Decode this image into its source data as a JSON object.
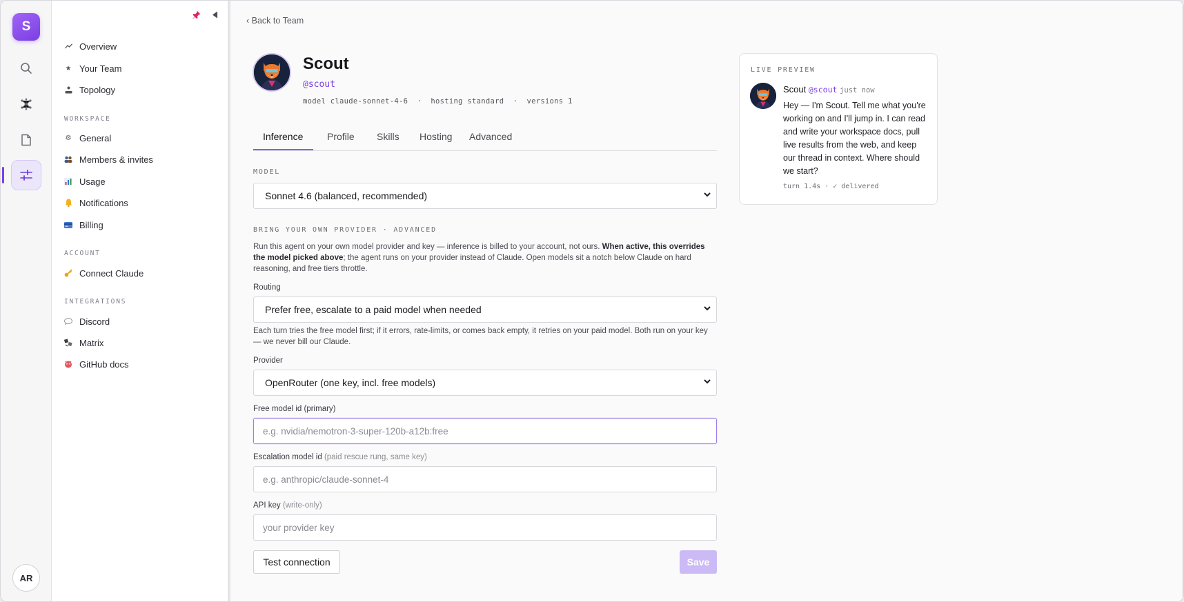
{
  "rail": {
    "logo_letter": "S",
    "avatar_initials": "AR",
    "buttons": [
      "search-icon",
      "graph-icon",
      "document-icon",
      "sliders-icon"
    ]
  },
  "sidebar": {
    "nav": [
      {
        "label": "Overview",
        "icon": "trend-icon"
      },
      {
        "label": "Your Team",
        "icon": "team-icon"
      },
      {
        "label": "Topology",
        "icon": "topology-icon"
      }
    ],
    "workspace_heading": "WORKSPACE",
    "workspace": [
      {
        "label": "General",
        "icon": "gear-icon"
      },
      {
        "label": "Members & invites",
        "icon": "members-icon"
      },
      {
        "label": "Usage",
        "icon": "bar-chart-icon"
      },
      {
        "label": "Notifications",
        "icon": "bell-icon"
      },
      {
        "label": "Billing",
        "icon": "card-icon"
      }
    ],
    "account_heading": "ACCOUNT",
    "account": [
      {
        "label": "Connect Claude",
        "icon": "key-icon"
      }
    ],
    "integrations_heading": "INTEGRATIONS",
    "integrations": [
      {
        "label": "Discord",
        "icon": "chat-icon"
      },
      {
        "label": "Matrix",
        "icon": "matrix-icon"
      },
      {
        "label": "GitHub docs",
        "icon": "github-icon"
      }
    ]
  },
  "header": {
    "back_label": "‹ Back to Team",
    "name": "Scout",
    "handle": "@scout",
    "meta": "model claude-sonnet-4-6  ·  hosting standard  ·  versions 1"
  },
  "tabs": [
    "Inference",
    "Profile",
    "Skills",
    "Hosting",
    "Advanced"
  ],
  "active_tab": "Inference",
  "form": {
    "model_label": "MODEL",
    "model_value": "Sonnet 4.6 (balanced, recommended)",
    "byop_heading": "BRING YOUR OWN PROVIDER · ADVANCED",
    "byop_help_1": "Run this agent on your own model provider and key — inference is billed to your account, not ours. ",
    "byop_help_bold": "When active, this overrides the model picked above",
    "byop_help_2": "; the agent runs on your provider instead of Claude. Open models sit a notch below Claude on hard reasoning, and free tiers throttle.",
    "routing_label": "Routing",
    "routing_value": "Prefer free, escalate to a paid model when needed",
    "routing_help": "Each turn tries the free model first; if it errors, rate-limits, or comes back empty, it retries on your paid model. Both run on your key — we never bill our Claude.",
    "provider_label": "Provider",
    "provider_value": "OpenRouter (one key, incl. free models)",
    "free_model_label": "Free model id (primary)",
    "free_model_placeholder": "e.g. nvidia/nemotron-3-super-120b-a12b:free",
    "escalation_label": "Escalation model id",
    "escalation_note": "(paid rescue rung, same key)",
    "escalation_placeholder": "e.g. anthropic/claude-sonnet-4",
    "api_key_label": "API key",
    "api_key_note": "(write-only)",
    "api_key_placeholder": "your provider key",
    "test_label": "Test connection",
    "save_label": "Save"
  },
  "preview": {
    "title": "LIVE PREVIEW",
    "name": "Scout",
    "handle": "@scout",
    "time": "just now",
    "message": "Hey — I'm Scout. Tell me what you're working on and I'll jump in. I can read and write your workspace docs, pull live results from the web, and keep our thread in context. Where should we start?",
    "footer": "turn 1.4s · ✓ delivered"
  },
  "colors": {
    "accent": "#7b3fe4",
    "save_disabled": "#ccbaf6"
  }
}
